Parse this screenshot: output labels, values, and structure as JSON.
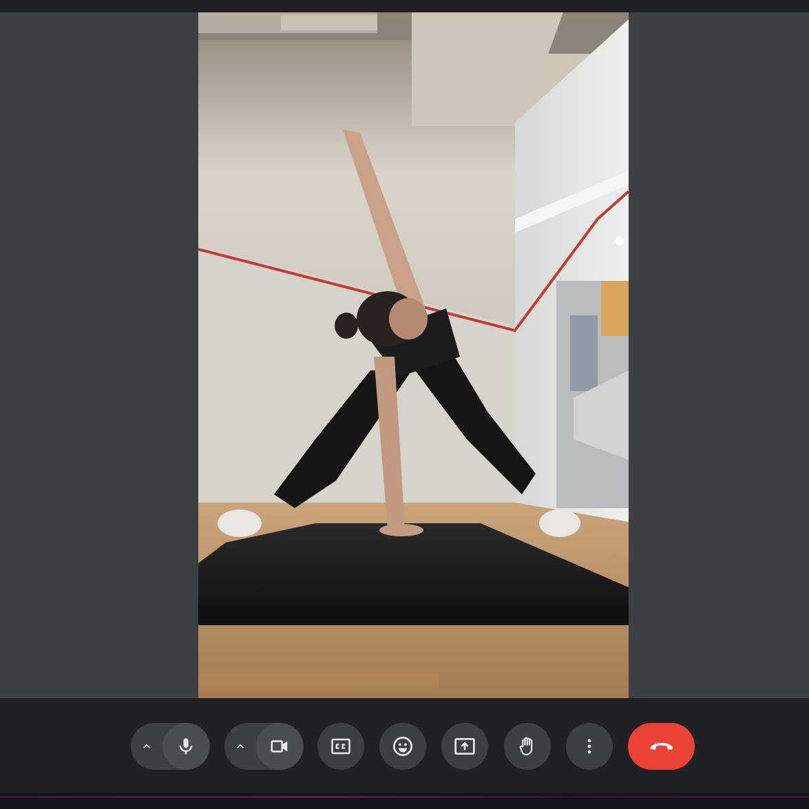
{
  "call": {
    "participant_video": "exercise-stretch-video"
  },
  "controls": {
    "mic": {
      "icon": "microphone-icon",
      "options_icon": "chevron-up-icon"
    },
    "camera": {
      "icon": "video-camera-icon",
      "options_icon": "chevron-up-icon"
    },
    "captions": {
      "icon": "closed-captions-icon"
    },
    "reactions": {
      "icon": "emoji-icon"
    },
    "present": {
      "icon": "present-screen-icon"
    },
    "raise_hand": {
      "icon": "raise-hand-icon"
    },
    "more": {
      "icon": "more-vertical-icon"
    },
    "leave": {
      "icon": "end-call-icon",
      "color": "#ea4335"
    }
  },
  "colors": {
    "background": "#3c4043",
    "control_bar": "#202124",
    "button": "#3c4043",
    "end_call": "#ea4335"
  }
}
